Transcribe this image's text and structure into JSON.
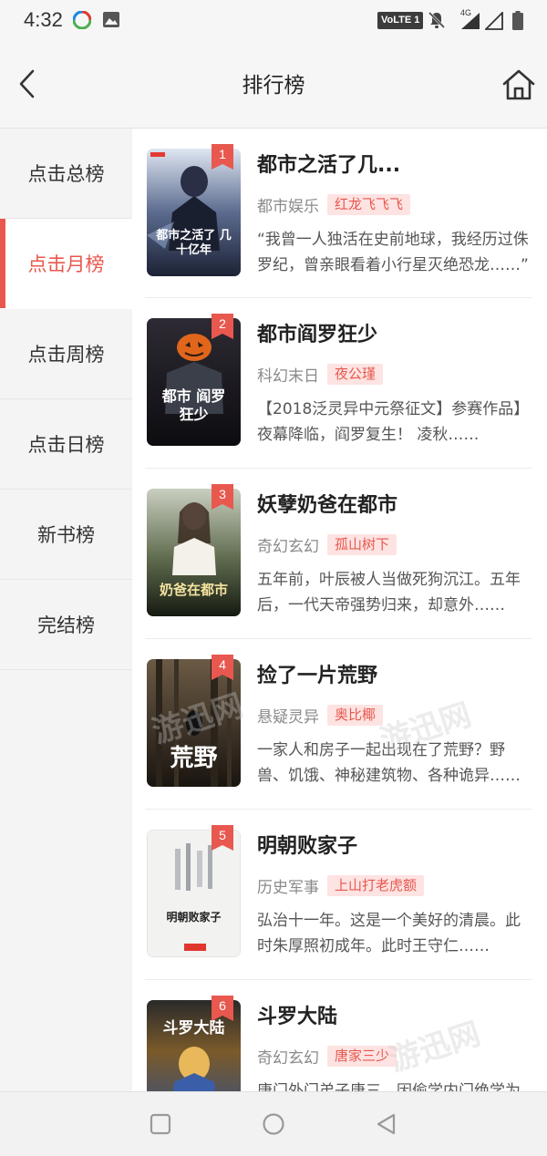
{
  "status_bar": {
    "time": "4:32",
    "volte_label": "VoLTE 1",
    "network_label": "4G"
  },
  "header": {
    "title": "排行榜",
    "back_icon": "chevron-left-icon",
    "home_icon": "home-icon"
  },
  "sidebar": {
    "items": [
      {
        "label": "点击总榜",
        "active": false
      },
      {
        "label": "点击月榜",
        "active": true
      },
      {
        "label": "点击周榜",
        "active": false
      },
      {
        "label": "点击日榜",
        "active": false
      },
      {
        "label": "新书榜",
        "active": false
      },
      {
        "label": "完结榜",
        "active": false
      }
    ]
  },
  "books": [
    {
      "rank": "1",
      "title": "都市之活了几...",
      "genre": "都市娱乐",
      "author": "红龙飞飞飞",
      "description": "“我曾一人独活在史前地球，我经历过侏罗纪，曾亲眼看着小行星灭绝恐龙……”",
      "cover_text": "都市之活了 几十亿年"
    },
    {
      "rank": "2",
      "title": "都市阎罗狂少",
      "genre": "科幻末日",
      "author": "夜公瑾",
      "description": "【2018泛灵异中元祭征文】参赛作品】 夜幕降临，阎罗复生！ 凌秋……",
      "cover_text": "都市 阎罗狂少"
    },
    {
      "rank": "3",
      "title": "妖孽奶爸在都市",
      "genre": "奇幻玄幻",
      "author": "孤山树下",
      "description": "五年前，叶辰被人当做死狗沉江。五年后，一代天帝强势归来，却意外……",
      "cover_text": "奶爸在都市"
    },
    {
      "rank": "4",
      "title": "捡了一片荒野",
      "genre": "悬疑灵异",
      "author": "奥比椰",
      "description": "一家人和房子一起出现在了荒野？野兽、饥饿、神秘建筑物、各种诡异……",
      "cover_text": "荒野"
    },
    {
      "rank": "5",
      "title": "明朝败家子",
      "genre": "历史军事",
      "author": "上山打老虎额",
      "description": "弘治十一年。这是一个美好的清晨。此时朱厚照初成年。此时王守仁……",
      "cover_text": "明朝败家子"
    },
    {
      "rank": "6",
      "title": "斗罗大陆",
      "genre": "奇幻玄幻",
      "author": "唐家三少",
      "description": "唐门外门弟子唐三，因偷学内门绝学为唐门所不容……",
      "cover_text": "斗罗大陆"
    }
  ],
  "watermark_text": "游迅网",
  "colors": {
    "accent": "#e8584e",
    "author_tag_bg": "#fde3e2"
  }
}
